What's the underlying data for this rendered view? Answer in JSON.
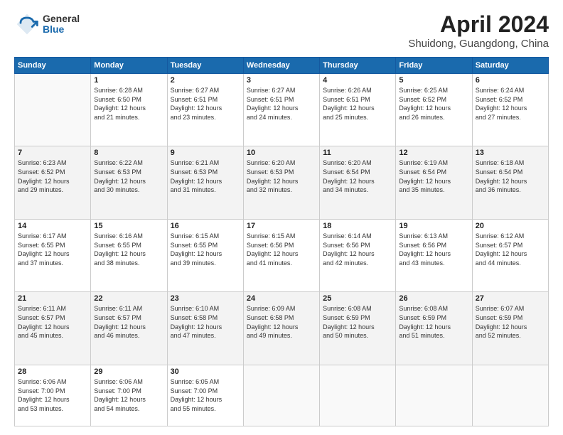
{
  "logo": {
    "general": "General",
    "blue": "Blue"
  },
  "title": {
    "month_year": "April 2024",
    "location": "Shuidong, Guangdong, China"
  },
  "weekdays": [
    "Sunday",
    "Monday",
    "Tuesday",
    "Wednesday",
    "Thursday",
    "Friday",
    "Saturday"
  ],
  "weeks": [
    [
      {
        "day": "",
        "empty": true
      },
      {
        "day": "1",
        "sunrise": "6:28 AM",
        "sunset": "6:50 PM",
        "daylight": "12 hours and 21 minutes."
      },
      {
        "day": "2",
        "sunrise": "6:27 AM",
        "sunset": "6:51 PM",
        "daylight": "12 hours and 23 minutes."
      },
      {
        "day": "3",
        "sunrise": "6:27 AM",
        "sunset": "6:51 PM",
        "daylight": "12 hours and 24 minutes."
      },
      {
        "day": "4",
        "sunrise": "6:26 AM",
        "sunset": "6:51 PM",
        "daylight": "12 hours and 25 minutes."
      },
      {
        "day": "5",
        "sunrise": "6:25 AM",
        "sunset": "6:52 PM",
        "daylight": "12 hours and 26 minutes."
      },
      {
        "day": "6",
        "sunrise": "6:24 AM",
        "sunset": "6:52 PM",
        "daylight": "12 hours and 27 minutes."
      }
    ],
    [
      {
        "day": "7",
        "sunrise": "6:23 AM",
        "sunset": "6:52 PM",
        "daylight": "12 hours and 29 minutes."
      },
      {
        "day": "8",
        "sunrise": "6:22 AM",
        "sunset": "6:53 PM",
        "daylight": "12 hours and 30 minutes."
      },
      {
        "day": "9",
        "sunrise": "6:21 AM",
        "sunset": "6:53 PM",
        "daylight": "12 hours and 31 minutes."
      },
      {
        "day": "10",
        "sunrise": "6:20 AM",
        "sunset": "6:53 PM",
        "daylight": "12 hours and 32 minutes."
      },
      {
        "day": "11",
        "sunrise": "6:20 AM",
        "sunset": "6:54 PM",
        "daylight": "12 hours and 34 minutes."
      },
      {
        "day": "12",
        "sunrise": "6:19 AM",
        "sunset": "6:54 PM",
        "daylight": "12 hours and 35 minutes."
      },
      {
        "day": "13",
        "sunrise": "6:18 AM",
        "sunset": "6:54 PM",
        "daylight": "12 hours and 36 minutes."
      }
    ],
    [
      {
        "day": "14",
        "sunrise": "6:17 AM",
        "sunset": "6:55 PM",
        "daylight": "12 hours and 37 minutes."
      },
      {
        "day": "15",
        "sunrise": "6:16 AM",
        "sunset": "6:55 PM",
        "daylight": "12 hours and 38 minutes."
      },
      {
        "day": "16",
        "sunrise": "6:15 AM",
        "sunset": "6:55 PM",
        "daylight": "12 hours and 39 minutes."
      },
      {
        "day": "17",
        "sunrise": "6:15 AM",
        "sunset": "6:56 PM",
        "daylight": "12 hours and 41 minutes."
      },
      {
        "day": "18",
        "sunrise": "6:14 AM",
        "sunset": "6:56 PM",
        "daylight": "12 hours and 42 minutes."
      },
      {
        "day": "19",
        "sunrise": "6:13 AM",
        "sunset": "6:56 PM",
        "daylight": "12 hours and 43 minutes."
      },
      {
        "day": "20",
        "sunrise": "6:12 AM",
        "sunset": "6:57 PM",
        "daylight": "12 hours and 44 minutes."
      }
    ],
    [
      {
        "day": "21",
        "sunrise": "6:11 AM",
        "sunset": "6:57 PM",
        "daylight": "12 hours and 45 minutes."
      },
      {
        "day": "22",
        "sunrise": "6:11 AM",
        "sunset": "6:57 PM",
        "daylight": "12 hours and 46 minutes."
      },
      {
        "day": "23",
        "sunrise": "6:10 AM",
        "sunset": "6:58 PM",
        "daylight": "12 hours and 47 minutes."
      },
      {
        "day": "24",
        "sunrise": "6:09 AM",
        "sunset": "6:58 PM",
        "daylight": "12 hours and 49 minutes."
      },
      {
        "day": "25",
        "sunrise": "6:08 AM",
        "sunset": "6:59 PM",
        "daylight": "12 hours and 50 minutes."
      },
      {
        "day": "26",
        "sunrise": "6:08 AM",
        "sunset": "6:59 PM",
        "daylight": "12 hours and 51 minutes."
      },
      {
        "day": "27",
        "sunrise": "6:07 AM",
        "sunset": "6:59 PM",
        "daylight": "12 hours and 52 minutes."
      }
    ],
    [
      {
        "day": "28",
        "sunrise": "6:06 AM",
        "sunset": "7:00 PM",
        "daylight": "12 hours and 53 minutes."
      },
      {
        "day": "29",
        "sunrise": "6:06 AM",
        "sunset": "7:00 PM",
        "daylight": "12 hours and 54 minutes."
      },
      {
        "day": "30",
        "sunrise": "6:05 AM",
        "sunset": "7:00 PM",
        "daylight": "12 hours and 55 minutes."
      },
      {
        "day": "",
        "empty": true
      },
      {
        "day": "",
        "empty": true
      },
      {
        "day": "",
        "empty": true
      },
      {
        "day": "",
        "empty": true
      }
    ]
  ]
}
